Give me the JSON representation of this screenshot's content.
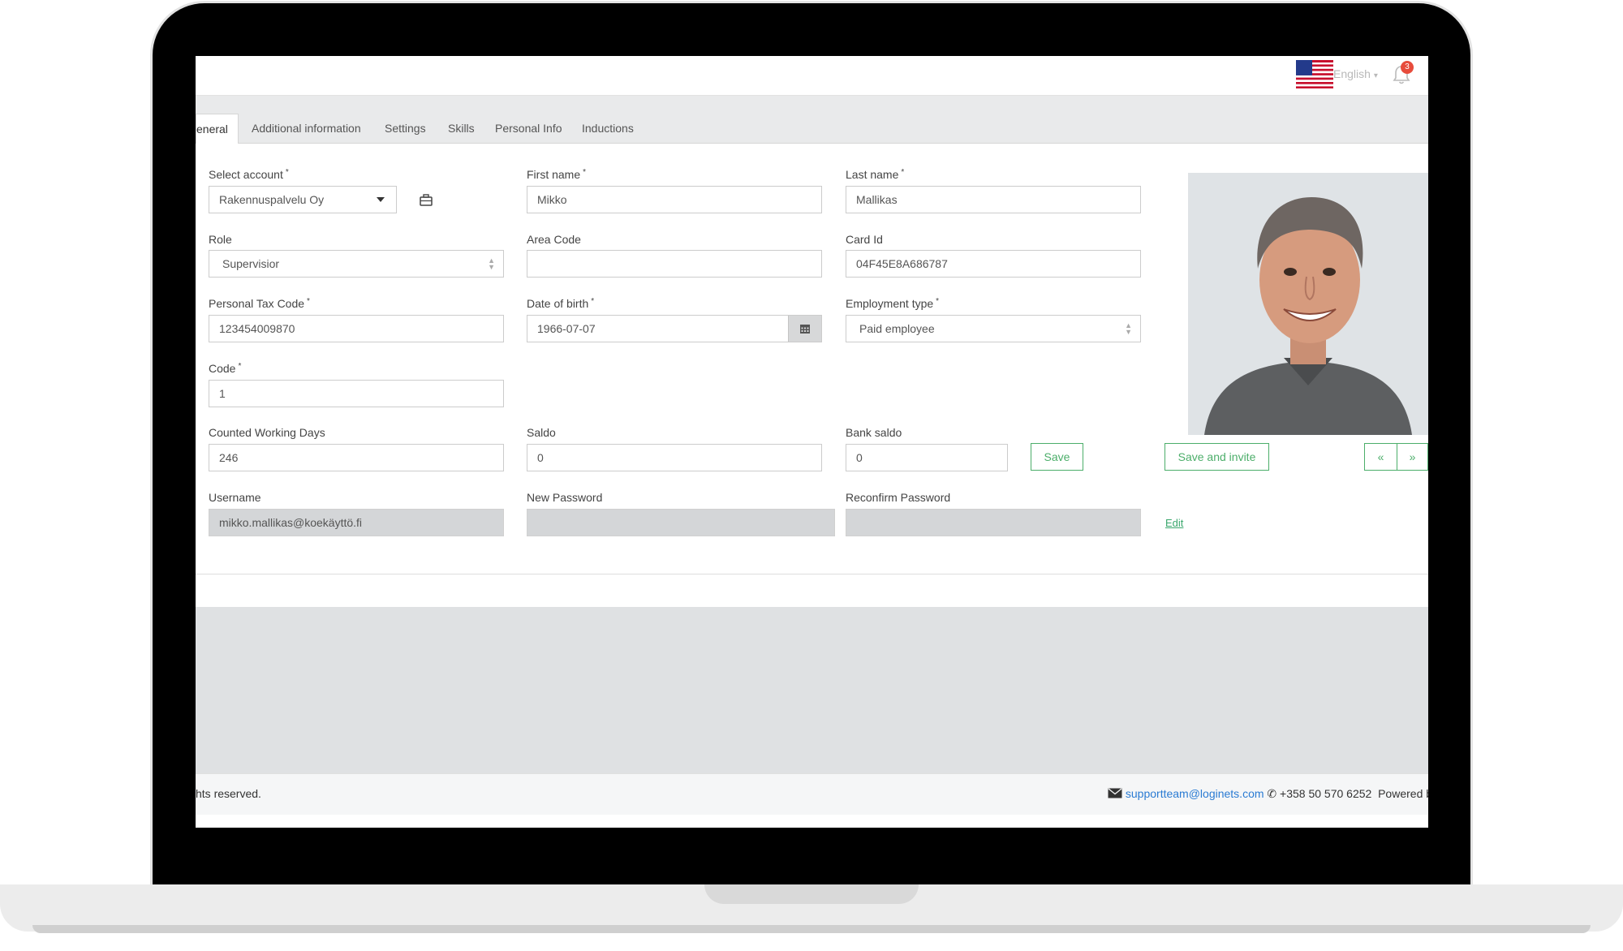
{
  "header": {
    "language": "English",
    "notification_count": "3"
  },
  "tabs": [
    {
      "label": "eneral",
      "active": true
    },
    {
      "label": "Additional information"
    },
    {
      "label": "Settings"
    },
    {
      "label": "Skills"
    },
    {
      "label": "Personal Info"
    },
    {
      "label": "Inductions"
    }
  ],
  "form": {
    "select_account": {
      "label": "Select account",
      "value": "Rakennuspalvelu Oy"
    },
    "first_name": {
      "label": "First name",
      "value": "Mikko"
    },
    "last_name": {
      "label": "Last name",
      "value": "Mallikas"
    },
    "role": {
      "label": "Role",
      "value": "Supervisior"
    },
    "area_code": {
      "label": "Area Code",
      "value": ""
    },
    "card_id": {
      "label": "Card Id",
      "value": "04F45E8A686787"
    },
    "personal_tax_code": {
      "label": "Personal Tax Code",
      "value": "123454009870"
    },
    "date_of_birth": {
      "label": "Date of birth",
      "value": "1966-07-07"
    },
    "employment_type": {
      "label": "Employment type",
      "value": "Paid employee"
    },
    "code": {
      "label": "Code",
      "value": "1"
    },
    "counted_working_days": {
      "label": "Counted Working Days",
      "value": "246"
    },
    "saldo": {
      "label": "Saldo",
      "value": "0"
    },
    "bank_saldo": {
      "label": "Bank saldo",
      "value": "0"
    },
    "username": {
      "label": "Username",
      "value": "mikko.mallikas@koekäyttö.fi"
    },
    "new_password": {
      "label": "New Password",
      "value": ""
    },
    "reconfirm_password": {
      "label": "Reconfirm Password",
      "value": ""
    },
    "required_mark": "*"
  },
  "buttons": {
    "save": "Save",
    "save_and_invite": "Save and invite",
    "prev": "«",
    "next": "»",
    "edit": "Edit"
  },
  "footer": {
    "rights": "hts reserved.",
    "email": "supportteam@loginets.com",
    "phone": "+358 50 570 6252",
    "powered": "Powered b"
  },
  "colors": {
    "accent_green": "#4cae6a",
    "link_blue": "#2a7bd3",
    "badge_red": "#e74c3c"
  },
  "icons": [
    "flag-us-icon",
    "chevron-down-icon",
    "bell-icon",
    "briefcase-icon",
    "calendar-icon",
    "envelope-icon",
    "phone-icon"
  ]
}
